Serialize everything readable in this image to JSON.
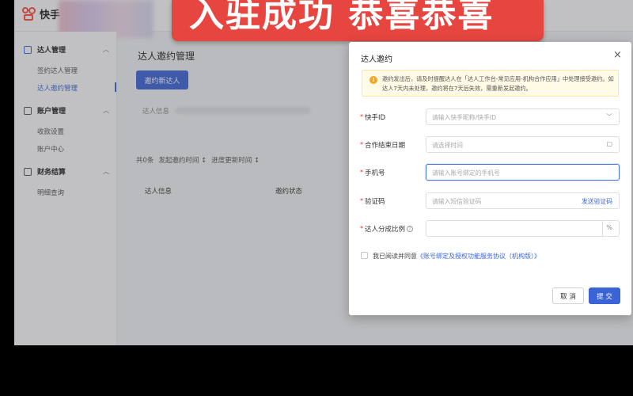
{
  "app": {
    "logo_text": "快手"
  },
  "banner": {
    "text": "入驻成功 恭喜恭喜"
  },
  "sidebar": {
    "groups": [
      {
        "label": "达人管理",
        "items": [
          "签约达人管理",
          "达人邀约管理"
        ]
      },
      {
        "label": "账户管理",
        "items": [
          "收款设置",
          "账户中心"
        ]
      },
      {
        "label": "财务结算",
        "items": [
          "明细查询"
        ]
      }
    ],
    "active_item": "达人邀约管理"
  },
  "main": {
    "title": "达人邀约管理",
    "invite_button": "邀约新达人",
    "filter_label": "达人信息",
    "stats": {
      "count": "共0条",
      "sort1": "发起邀约时间 ↕",
      "sort2": "进度更新时间 ↕"
    },
    "table_headers": [
      "达人信息",
      "邀约状态"
    ]
  },
  "modal": {
    "title": "达人邀约",
    "close": "×",
    "notice": "邀约发出后，请及时提醒达人在「达人工作台-常见应用-机构合作应用」中处理接受邀约。如达人7天内未处理，邀约将在7天后失效，需重新发起邀约。",
    "fields": {
      "kuaishou_id": {
        "label": "快手ID",
        "placeholder": "请输入快手昵称/快手ID"
      },
      "end_date": {
        "label": "合作结束日期",
        "placeholder": "请选择时间"
      },
      "phone": {
        "label": "手机号",
        "placeholder": "请输入账号绑定的手机号"
      },
      "code": {
        "label": "验证码",
        "placeholder": "请输入短信验证码",
        "send_label": "发送验证码"
      },
      "ratio": {
        "label": "达人分成比例",
        "suffix": "%"
      }
    },
    "agreement": {
      "prefix": "我已阅读并同意",
      "link": "《账号绑定及授权功能服务协议（机构版）》"
    },
    "buttons": {
      "cancel": "取 消",
      "submit": "提 交"
    }
  }
}
